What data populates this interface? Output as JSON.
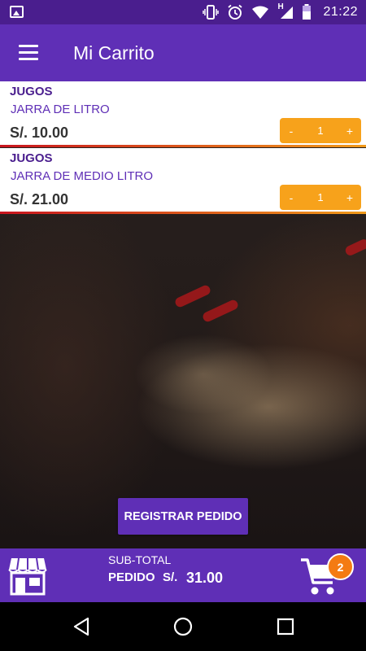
{
  "status_bar": {
    "time": "21:22",
    "network_letter": "H",
    "icons": [
      "image-icon",
      "vibrate-icon",
      "alarm-icon",
      "wifi-icon",
      "signal-icon",
      "battery-icon"
    ]
  },
  "app_bar": {
    "title": "Mi Carrito",
    "menu_icon": "hamburger-menu-icon"
  },
  "cart_items": [
    {
      "category": "JUGOS",
      "product": "JARRA DE LITRO",
      "price": "S/. 10.00",
      "minus": "-",
      "quantity": "1",
      "plus": "+"
    },
    {
      "category": "JUGOS",
      "product": "JARRA DE MEDIO LITRO",
      "price": "S/. 21.00",
      "minus": "-",
      "quantity": "1",
      "plus": "+"
    }
  ],
  "register_button": "REGISTRAR PEDIDO",
  "summary": {
    "subtotal_label": "SUB-TOTAL",
    "pedido_label": "PEDIDO",
    "currency": "S/.",
    "total": "31.00",
    "cart_count": "2",
    "store_icon": "store-icon",
    "cart_icon": "shopping-cart-icon"
  },
  "colors": {
    "primary": "#5f2fb6",
    "primary_dark": "#4a1e8e",
    "accent": "#f7a21b",
    "badge": "#f47b12"
  },
  "nav_bar": {
    "icons": [
      "back-icon",
      "home-icon",
      "recents-icon"
    ]
  }
}
